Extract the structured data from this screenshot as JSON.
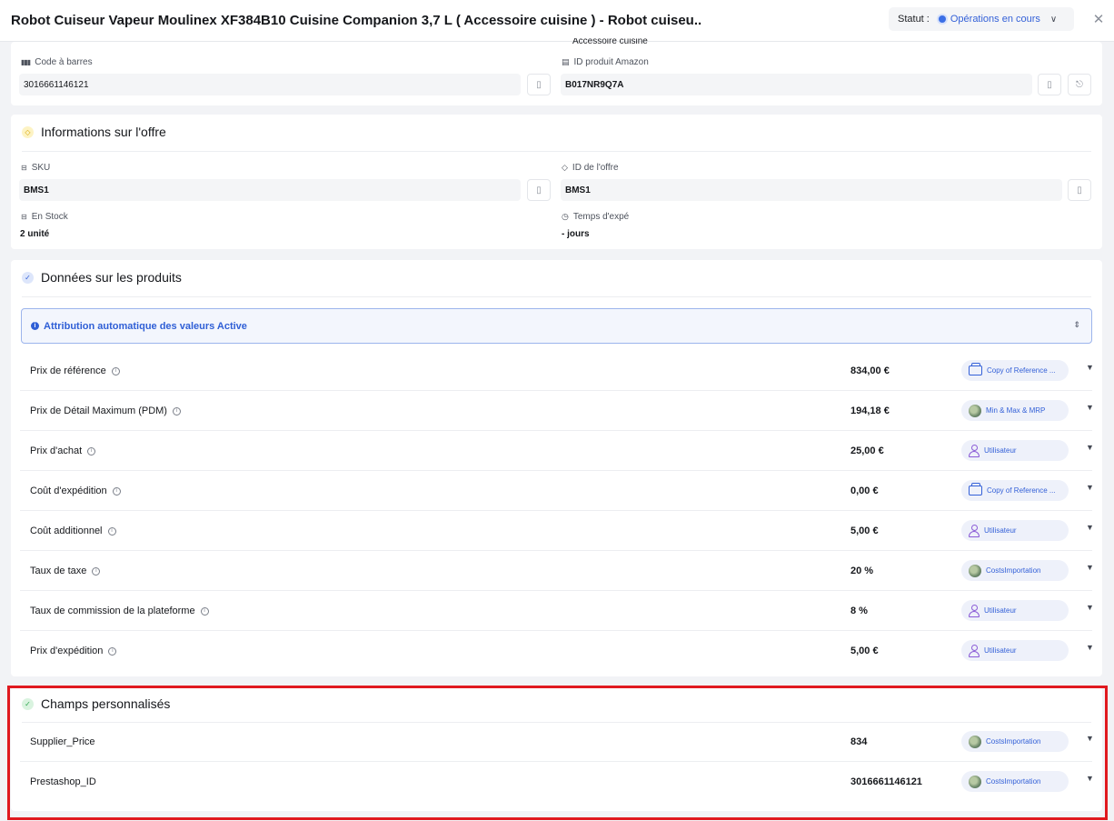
{
  "header": {
    "title": "Robot Cuiseur Vapeur Moulinex XF384B10 Cuisine Companion 3,7 L ( Accessoire cuisine ) - Robot cuiseu...",
    "status_label": "Statut :",
    "status_value": "Opérations en cours",
    "close_glyph": "✕"
  },
  "product_card": {
    "cut_text": "Accessoire cuisine",
    "barcode_label": "Code à barres",
    "barcode_value": "3016661146121",
    "amazon_label": "ID produit Amazon",
    "amazon_value": "B017NR9Q7A"
  },
  "offer_card": {
    "title": "Informations sur l'offre",
    "sku_label": "SKU",
    "sku_value": "BMS1",
    "offer_id_label": "ID de l'offre",
    "offer_id_value": "BMS1",
    "stock_label": "En Stock",
    "stock_value": "2 unité",
    "shipping_time_label": "Temps d'expé",
    "shipping_time_value": "- jours"
  },
  "product_data_card": {
    "title": "Données sur les produits",
    "auto_attribution": "Attribution automatique des valeurs Active",
    "rows": [
      {
        "label": "Prix de référence",
        "value": "834,00 €",
        "source": "Copy of Reference ...",
        "icon": "copy"
      },
      {
        "label": "Prix de Détail Maximum (PDM)",
        "value": "194,18 €",
        "source": "Min & Max & MRP",
        "icon": "globe"
      },
      {
        "label": "Prix d'achat",
        "value": "25,00 €",
        "source": "Utilisateur",
        "icon": "user"
      },
      {
        "label": "Coût d'expédition",
        "value": "0,00 €",
        "source": "Copy of Reference ...",
        "icon": "copy"
      },
      {
        "label": "Coût additionnel",
        "value": "5,00 €",
        "source": "Utilisateur",
        "icon": "user"
      },
      {
        "label": "Taux de taxe",
        "value": "20 %",
        "source": "CostsImportation",
        "icon": "globe"
      },
      {
        "label": "Taux de commission de la plateforme",
        "value": "8 %",
        "source": "Utilisateur",
        "icon": "user"
      },
      {
        "label": "Prix d'expédition",
        "value": "5,00 €",
        "source": "Utilisateur",
        "icon": "user"
      }
    ]
  },
  "custom_fields_card": {
    "title": "Champs personnalisés",
    "rows": [
      {
        "label": "Supplier_Price",
        "value": "834",
        "source": "CostsImportation",
        "icon": "globe"
      },
      {
        "label": "Prestashop_ID",
        "value": "3016661146121",
        "source": "CostsImportation",
        "icon": "globe"
      }
    ]
  },
  "colors": {
    "accent": "#3461d8",
    "highlight": "#e0191f",
    "user_icon": "#8b5cd6"
  }
}
